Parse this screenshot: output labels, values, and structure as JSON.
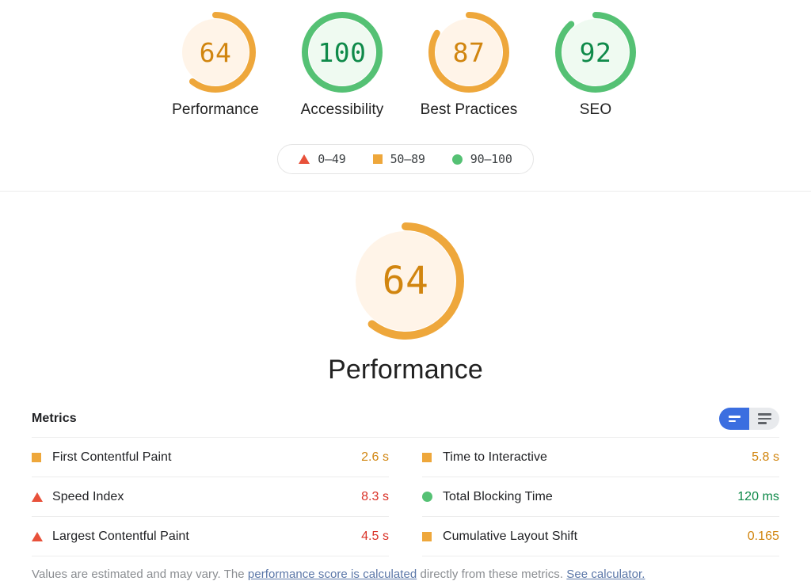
{
  "summary": {
    "gauges": [
      {
        "score": "64",
        "label": "Performance",
        "category": "average",
        "pct": 64
      },
      {
        "score": "100",
        "label": "Accessibility",
        "category": "pass",
        "pct": 100
      },
      {
        "score": "87",
        "label": "Best Practices",
        "category": "average",
        "pct": 87
      },
      {
        "score": "92",
        "label": "SEO",
        "category": "pass",
        "pct": 92
      }
    ],
    "legend": [
      {
        "icon": "triangle-icon",
        "range": "0–49",
        "color": "#e8513a"
      },
      {
        "icon": "square-icon",
        "range": "50–89",
        "color": "#eea73b"
      },
      {
        "icon": "circle-icon",
        "range": "90–100",
        "color": "#55c174"
      }
    ]
  },
  "detail": {
    "gauge": {
      "score": "64",
      "pct": 64,
      "category": "average"
    },
    "title": "Performance",
    "metrics_header": "Metrics",
    "toggle": {
      "active_option": "simple-view",
      "inactive_option": "detailed-view",
      "active_color": "#3b6ee0",
      "inactive_color": "#e8eaed"
    },
    "metrics_left": [
      {
        "icon": "square-icon",
        "name": "First Contentful Paint",
        "value": "2.6 s",
        "category": "average"
      },
      {
        "icon": "triangle-icon",
        "name": "Speed Index",
        "value": "8.3 s",
        "category": "fail"
      },
      {
        "icon": "triangle-icon",
        "name": "Largest Contentful Paint",
        "value": "4.5 s",
        "category": "fail"
      }
    ],
    "metrics_right": [
      {
        "icon": "square-icon",
        "name": "Time to Interactive",
        "value": "5.8 s",
        "category": "average"
      },
      {
        "icon": "circle-icon",
        "name": "Total Blocking Time",
        "value": "120 ms",
        "category": "pass"
      },
      {
        "icon": "square-icon",
        "name": "Cumulative Layout Shift",
        "value": "0.165",
        "category": "average"
      }
    ],
    "footer": {
      "text_1": "Values are estimated and may vary. The ",
      "link_1": "performance score is calculated",
      "text_2": " directly from these metrics. ",
      "link_2": "See calculator."
    }
  },
  "colors": {
    "fail": "#e8513a",
    "average": "#eea73b",
    "pass": "#55c174",
    "average_text": "#d1850f",
    "fail_text": "#d93025",
    "pass_text": "#0f8a4a",
    "average_fill": "#fff4e8",
    "pass_fill": "#effaf1",
    "link": "#5b77a8"
  }
}
